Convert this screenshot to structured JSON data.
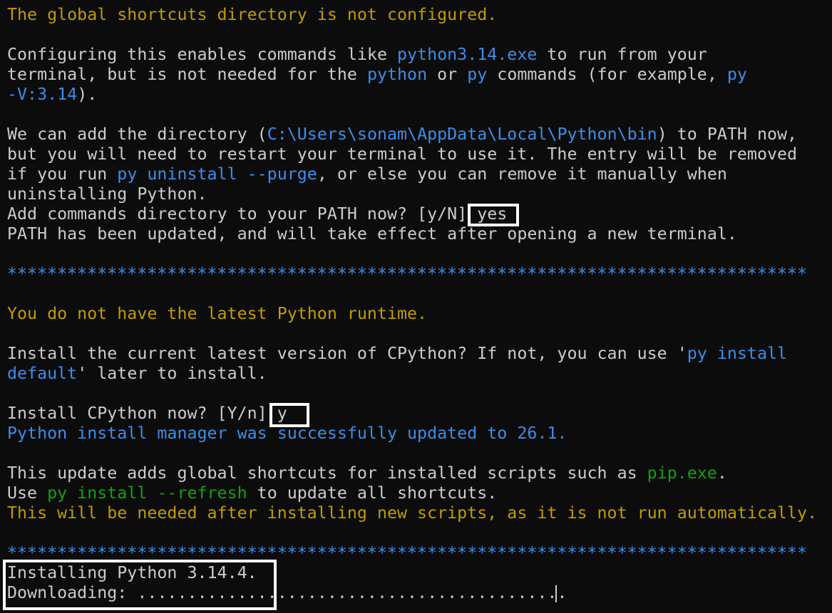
{
  "terminal": {
    "lines": [
      [
        {
          "t": "The global shortcuts directory is not configured.",
          "c": "y"
        }
      ],
      [],
      [
        {
          "t": "Configuring this enables commands like ",
          "c": "w"
        },
        {
          "t": "python3.14.exe",
          "c": "b"
        },
        {
          "t": " to run from your",
          "c": "w"
        }
      ],
      [
        {
          "t": "terminal, but is not needed for the ",
          "c": "w"
        },
        {
          "t": "python",
          "c": "b"
        },
        {
          "t": " or ",
          "c": "w"
        },
        {
          "t": "py",
          "c": "b"
        },
        {
          "t": " commands (for example, ",
          "c": "w"
        },
        {
          "t": "py",
          "c": "b"
        }
      ],
      [
        {
          "t": "-V:3.14",
          "c": "b"
        },
        {
          "t": ").",
          "c": "w"
        }
      ],
      [],
      [
        {
          "t": "We can add the directory (",
          "c": "w"
        },
        {
          "t": "C:\\Users\\sonam\\AppData\\Local\\Python\\bin",
          "c": "b"
        },
        {
          "t": ") to PATH now,",
          "c": "w"
        }
      ],
      [
        {
          "t": "but you will need to restart your terminal to use it. The entry will be removed",
          "c": "w"
        }
      ],
      [
        {
          "t": "if you run ",
          "c": "w"
        },
        {
          "t": "py uninstall --purge",
          "c": "b"
        },
        {
          "t": ", or else you can remove it manually when",
          "c": "w"
        }
      ],
      [
        {
          "t": "uninstalling Python.",
          "c": "w"
        }
      ],
      [
        {
          "t": "Add commands directory to your PATH now? [y/N] yes",
          "c": "w"
        }
      ],
      [
        {
          "t": "PATH has been updated, and will take effect after opening a new terminal.",
          "c": "w"
        }
      ],
      [],
      [
        {
          "t": "********************************************************************************",
          "c": "b"
        }
      ],
      [],
      [
        {
          "t": "You do not have the latest Python runtime.",
          "c": "y"
        }
      ],
      [],
      [
        {
          "t": "Install the current latest version of CPython? If not, you can use '",
          "c": "w"
        },
        {
          "t": "py install",
          "c": "b"
        }
      ],
      [
        {
          "t": "default",
          "c": "b"
        },
        {
          "t": "' later to install.",
          "c": "w"
        }
      ],
      [],
      [
        {
          "t": "Install CPython now? [Y/n] y",
          "c": "w"
        }
      ],
      [
        {
          "t": "Python install manager was successfully updated to 26.1.",
          "c": "b"
        }
      ],
      [],
      [
        {
          "t": "This update adds global shortcuts for installed scripts such as ",
          "c": "w"
        },
        {
          "t": "pip.exe",
          "c": "g"
        },
        {
          "t": ".",
          "c": "w"
        }
      ],
      [
        {
          "t": "Use ",
          "c": "w"
        },
        {
          "t": "py install --refresh",
          "c": "g"
        },
        {
          "t": " to update all shortcuts.",
          "c": "w"
        }
      ],
      [
        {
          "t": "This will be needed after installing new scripts, as it is not run automatically.",
          "c": "y"
        }
      ],
      [],
      [
        {
          "t": "********************************************************************************",
          "c": "b"
        }
      ],
      [
        {
          "t": "Installing Python 3.14.4.",
          "c": "w"
        }
      ],
      [
        {
          "t": "Downloading: ...........................................",
          "c": "w"
        }
      ]
    ]
  },
  "colors": {
    "background": "#0c0c0c",
    "foreground": "#cccccc",
    "yellow": "#c19c00",
    "blue": "#3b8eea",
    "green": "#13a10e",
    "highlight_box": "#ffffff"
  }
}
